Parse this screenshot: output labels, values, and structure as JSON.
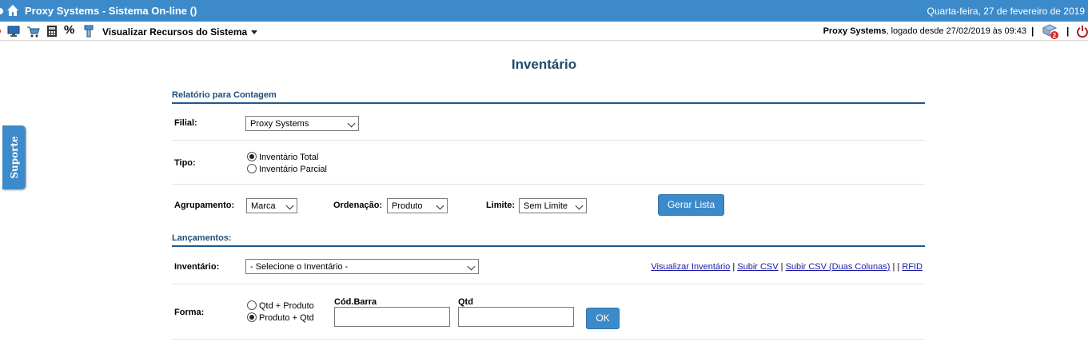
{
  "titlebar": {
    "title": "Proxy Systems - Sistema On-line ()",
    "date": "Quarta-feira, 27 de fevereiro de 2019"
  },
  "toolbar": {
    "menu_label": "Visualizar Recursos do Sistema",
    "user_name": "Proxy Systems",
    "user_status": ", logado desde 27/02/2019 às 09:43",
    "separator": "|",
    "notification_count": "2"
  },
  "support_tab": {
    "label": "Suporte"
  },
  "page": {
    "title": "Inventário"
  },
  "relatorio": {
    "heading": "Relatório para Contagem",
    "filial_label": "Filial:",
    "filial_value": "Proxy Systems",
    "tipo_label": "Tipo:",
    "tipo_options": [
      "Inventário Total",
      "Inventário Parcial"
    ],
    "tipo_selected": 0,
    "agrupamento_label": "Agrupamento:",
    "agrupamento_value": "Marca",
    "ordenacao_label": "Ordenação:",
    "ordenacao_value": "Produto",
    "limite_label": "Limite:",
    "limite_value": "Sem Limite",
    "gerar_button": "Gerar Lista"
  },
  "lancamentos": {
    "heading": "Lançamentos:",
    "inventario_label": "Inventário:",
    "inventario_value": "- Selecione o Inventário -",
    "links": [
      "Visualizar Inventário",
      "Subir CSV",
      "Subir CSV (Duas Colunas)",
      "RFID"
    ],
    "forma_label": "Forma:",
    "forma_options": [
      "Qtd + Produto",
      "Produto + Qtd"
    ],
    "forma_selected": 1,
    "codbarra_label": "Cód.Barra",
    "qtd_label": "Qtd",
    "ok_button": "OK"
  },
  "colors": {
    "accent": "#3c8ac9",
    "heading": "#1c4a6e",
    "link": "#1a1aa6"
  }
}
